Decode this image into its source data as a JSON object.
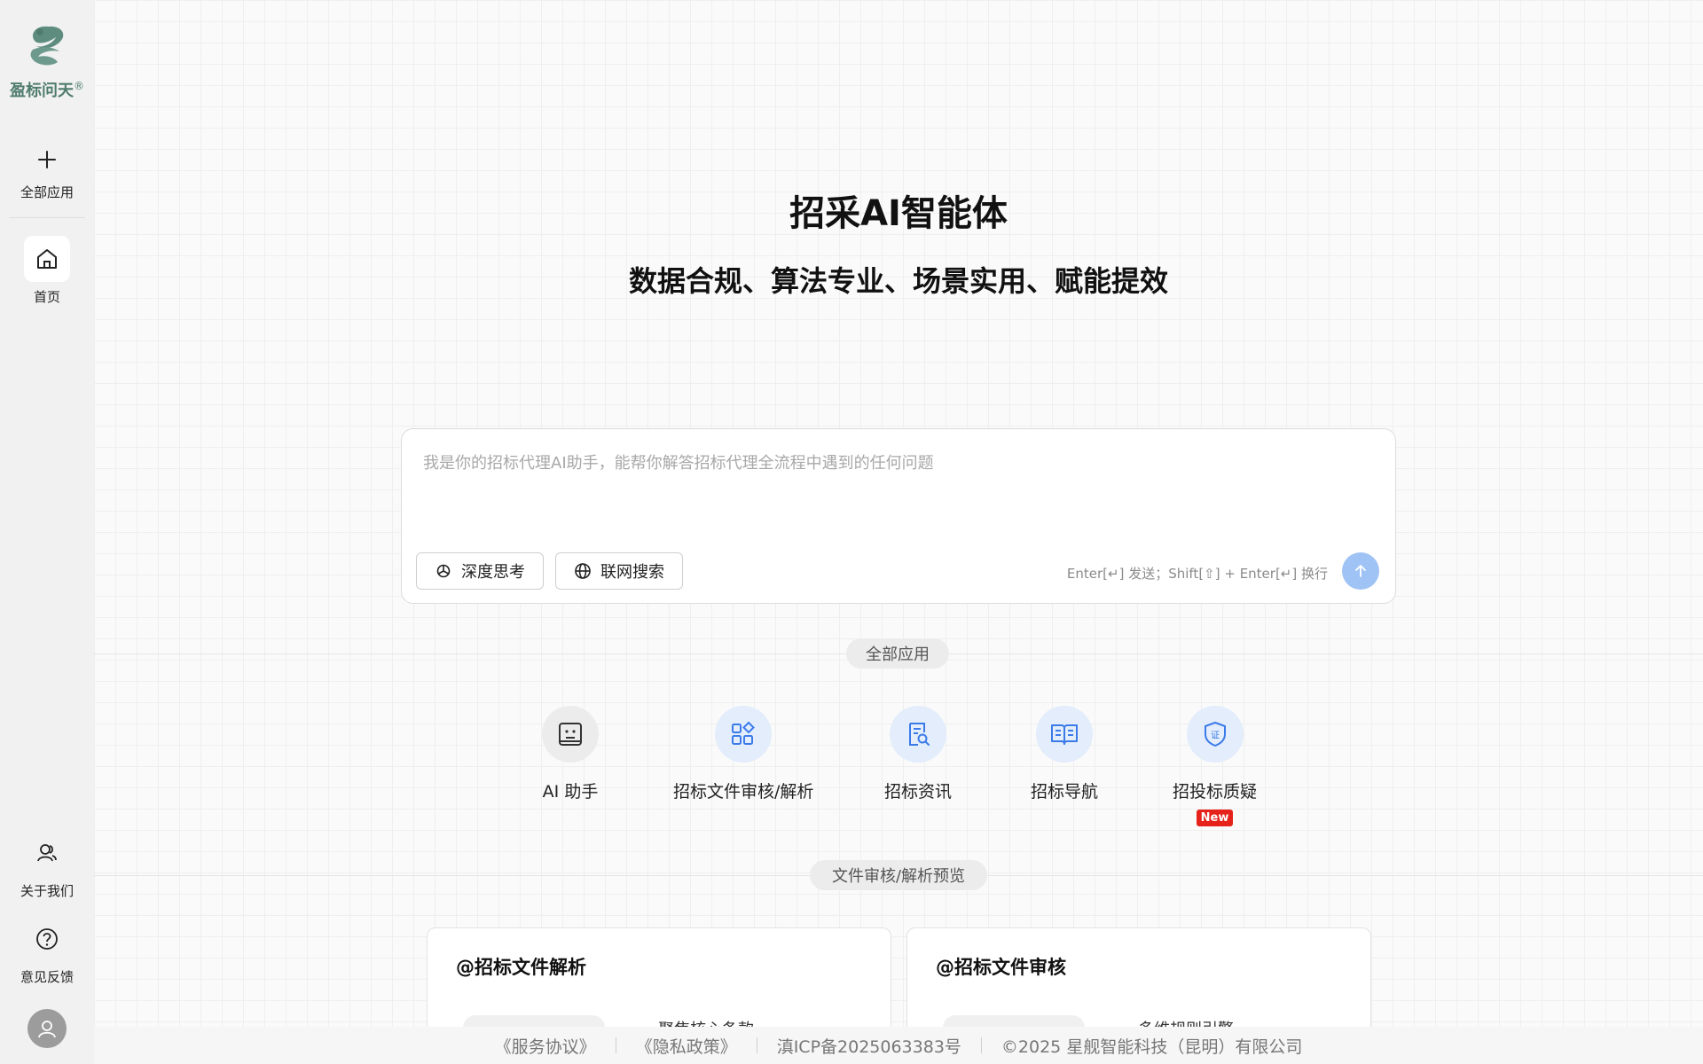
{
  "sidebar": {
    "logo_text": "盈标问天",
    "logo_reg": "®",
    "items": [
      {
        "label": "全部应用",
        "icon": "plus-icon"
      },
      {
        "label": "首页",
        "icon": "home-icon"
      }
    ],
    "bottom_items": [
      {
        "label": "关于我们",
        "icon": "users-icon"
      },
      {
        "label": "意见反馈",
        "icon": "help-circle-icon"
      }
    ],
    "avatar_icon": "user-icon"
  },
  "hero": {
    "title": "招采AI智能体",
    "subtitle": "数据合规、算法专业、场景实用、赋能提效"
  },
  "chat": {
    "placeholder": "我是你的招标代理AI助手，能帮你解答招标代理全流程中遇到的任何问题",
    "deep_think_label": "深度思考",
    "web_search_label": "联网搜索",
    "hint": "Enter[↵] 发送；Shift[⇧] + Enter[↵] 换行",
    "send_icon": "arrow-up-icon"
  },
  "apps_section": {
    "label": "全部应用",
    "apps": [
      {
        "name": "AI 助手",
        "icon": "robot-icon"
      },
      {
        "name": "招标文件审核/解析",
        "icon": "apps-grid-icon"
      },
      {
        "name": "招标资讯",
        "icon": "doc-search-icon"
      },
      {
        "name": "招标导航",
        "icon": "open-book-icon"
      },
      {
        "name": "招投标质疑",
        "icon": "shield-cert-icon",
        "badge": "New"
      }
    ]
  },
  "preview_section": {
    "label": "文件审核/解析预览",
    "cards": [
      {
        "title": "@招标文件解析",
        "line": "聚焦核心条款"
      },
      {
        "title": "@招标文件审核",
        "line": "多维规则引擎"
      }
    ]
  },
  "footer": {
    "service": "《服务协议》",
    "privacy": "《隐私政策》",
    "icp": "滇ICP备2025063383号",
    "copyright": "©2025 星舰智能科技（昆明）有限公司"
  },
  "colors": {
    "accent": "#3b7be8",
    "send_button": "#9fc3f5",
    "badge": "#e5231b",
    "logo": "#4f7c6e"
  }
}
